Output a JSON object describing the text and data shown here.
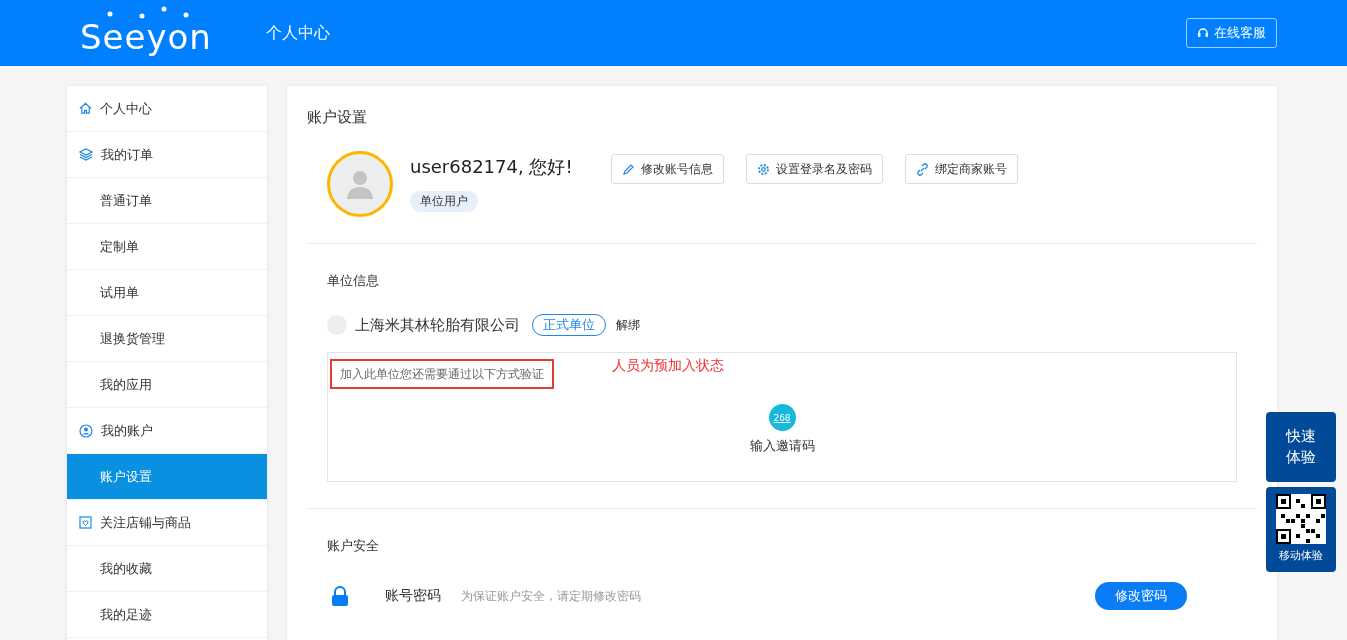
{
  "header": {
    "logo": "Seeyon",
    "title": "个人中心",
    "service_button": "在线客服"
  },
  "sidebar": {
    "items": [
      {
        "label": "个人中心",
        "kind": "group",
        "selected": false
      },
      {
        "label": "我的订单",
        "kind": "group",
        "selected": false
      },
      {
        "label": "普通订单",
        "kind": "sub",
        "selected": false
      },
      {
        "label": "定制单",
        "kind": "sub",
        "selected": false
      },
      {
        "label": "试用单",
        "kind": "sub",
        "selected": false
      },
      {
        "label": "退换货管理",
        "kind": "sub",
        "selected": false
      },
      {
        "label": "我的应用",
        "kind": "sub",
        "selected": false
      },
      {
        "label": "我的账户",
        "kind": "group",
        "selected": false
      },
      {
        "label": "账户设置",
        "kind": "sub",
        "selected": true
      },
      {
        "label": "关注店铺与商品",
        "kind": "group",
        "selected": false
      },
      {
        "label": "我的收藏",
        "kind": "sub",
        "selected": false
      },
      {
        "label": "我的足迹",
        "kind": "sub",
        "selected": false
      }
    ]
  },
  "main": {
    "title": "账户设置",
    "profile": {
      "greeting": "user682174, 您好!",
      "tag": "单位用户",
      "buttons": [
        "修改账号信息",
        "设置登录名及密码",
        "绑定商家账号"
      ]
    },
    "unit": {
      "heading": "单位信息",
      "company": "上海米其林轮胎有限公司",
      "status": "正式单位",
      "unbind": "解绑",
      "verify_hint": "加入此单位您还需要通过以下方式验证",
      "annotation": "人员为预加入状态",
      "code_badge": "268",
      "code_label": "输入邀请码"
    },
    "security": {
      "heading": "账户安全",
      "label": "账号密码",
      "hint": "为保证账户安全，请定期修改密码",
      "button": "修改密码"
    }
  },
  "float": {
    "quick": "快速体验",
    "mobile": "移动体验"
  }
}
